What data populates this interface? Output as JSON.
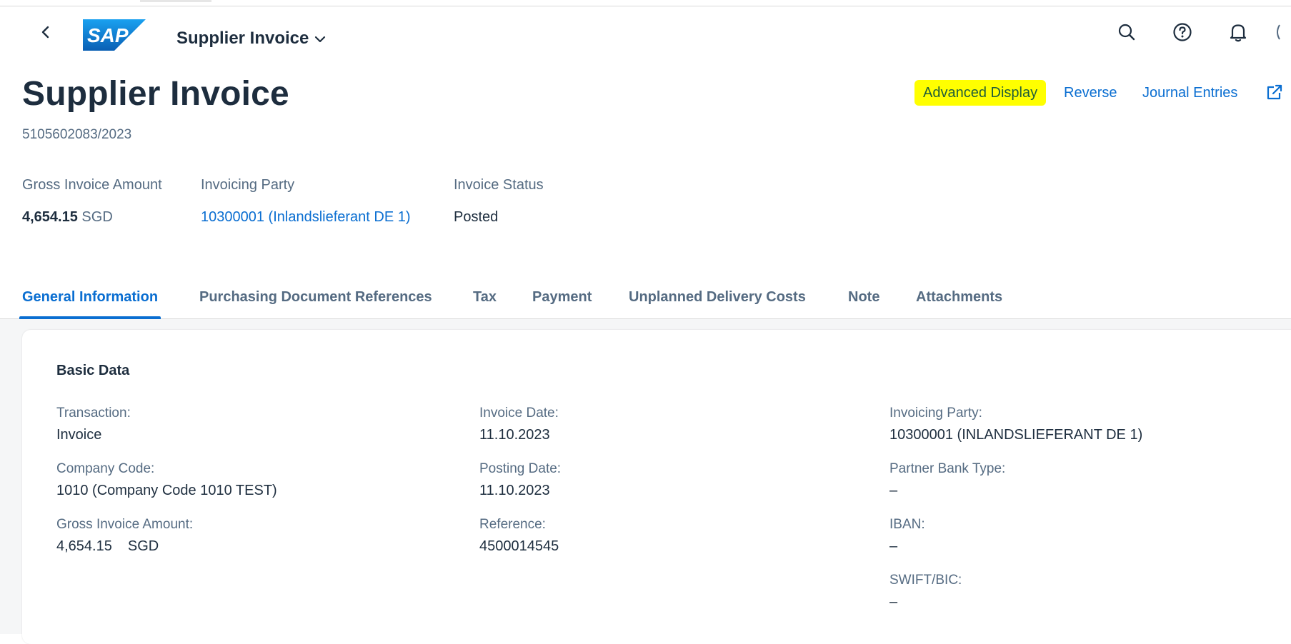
{
  "shell": {
    "app_title": "Supplier Invoice",
    "logo_text": "SAP"
  },
  "header": {
    "title": "Supplier Invoice",
    "subtitle": "5105602083/2023",
    "actions": [
      "Advanced Display",
      "Reverse",
      "Journal Entries"
    ]
  },
  "kpis": {
    "gross_amount": {
      "label": "Gross Invoice Amount",
      "value": "4,654.15",
      "unit": "SGD"
    },
    "invoicing_party": {
      "label": "Invoicing Party",
      "value": "10300001 (Inlandslieferant DE 1)"
    },
    "invoice_status": {
      "label": "Invoice Status",
      "value": "Posted"
    }
  },
  "tabs": [
    {
      "label": "General Information",
      "active": true
    },
    {
      "label": "Purchasing Document References",
      "active": false
    },
    {
      "label": "Tax",
      "active": false
    },
    {
      "label": "Payment",
      "active": false
    },
    {
      "label": "Unplanned Delivery Costs",
      "active": false
    },
    {
      "label": "Note",
      "active": false
    },
    {
      "label": "Attachments",
      "active": false
    }
  ],
  "basic_data": {
    "title": "Basic Data",
    "col1": [
      {
        "label": "Transaction:",
        "value": "Invoice"
      },
      {
        "label": "Company Code:",
        "value": "1010 (Company Code 1010 TEST)"
      },
      {
        "label": "Gross Invoice Amount:",
        "amount": "4,654.15",
        "currency": "SGD"
      }
    ],
    "col2": [
      {
        "label": "Invoice Date:",
        "value": "11.10.2023"
      },
      {
        "label": "Posting Date:",
        "value": "11.10.2023"
      },
      {
        "label": "Reference:",
        "value": "4500014545"
      }
    ],
    "col3": [
      {
        "label": "Invoicing Party:",
        "value": "10300001 (INLANDSLIEFERANT DE 1)"
      },
      {
        "label": "Partner Bank Type:",
        "value": "–"
      },
      {
        "label": "IBAN:",
        "value": "–"
      },
      {
        "label": "SWIFT/BIC:",
        "value": "–"
      }
    ]
  },
  "colors": {
    "accent": "#0a6ed1",
    "text": "#1d2d3e",
    "label": "#556b82",
    "highlight": "#ffff00"
  }
}
